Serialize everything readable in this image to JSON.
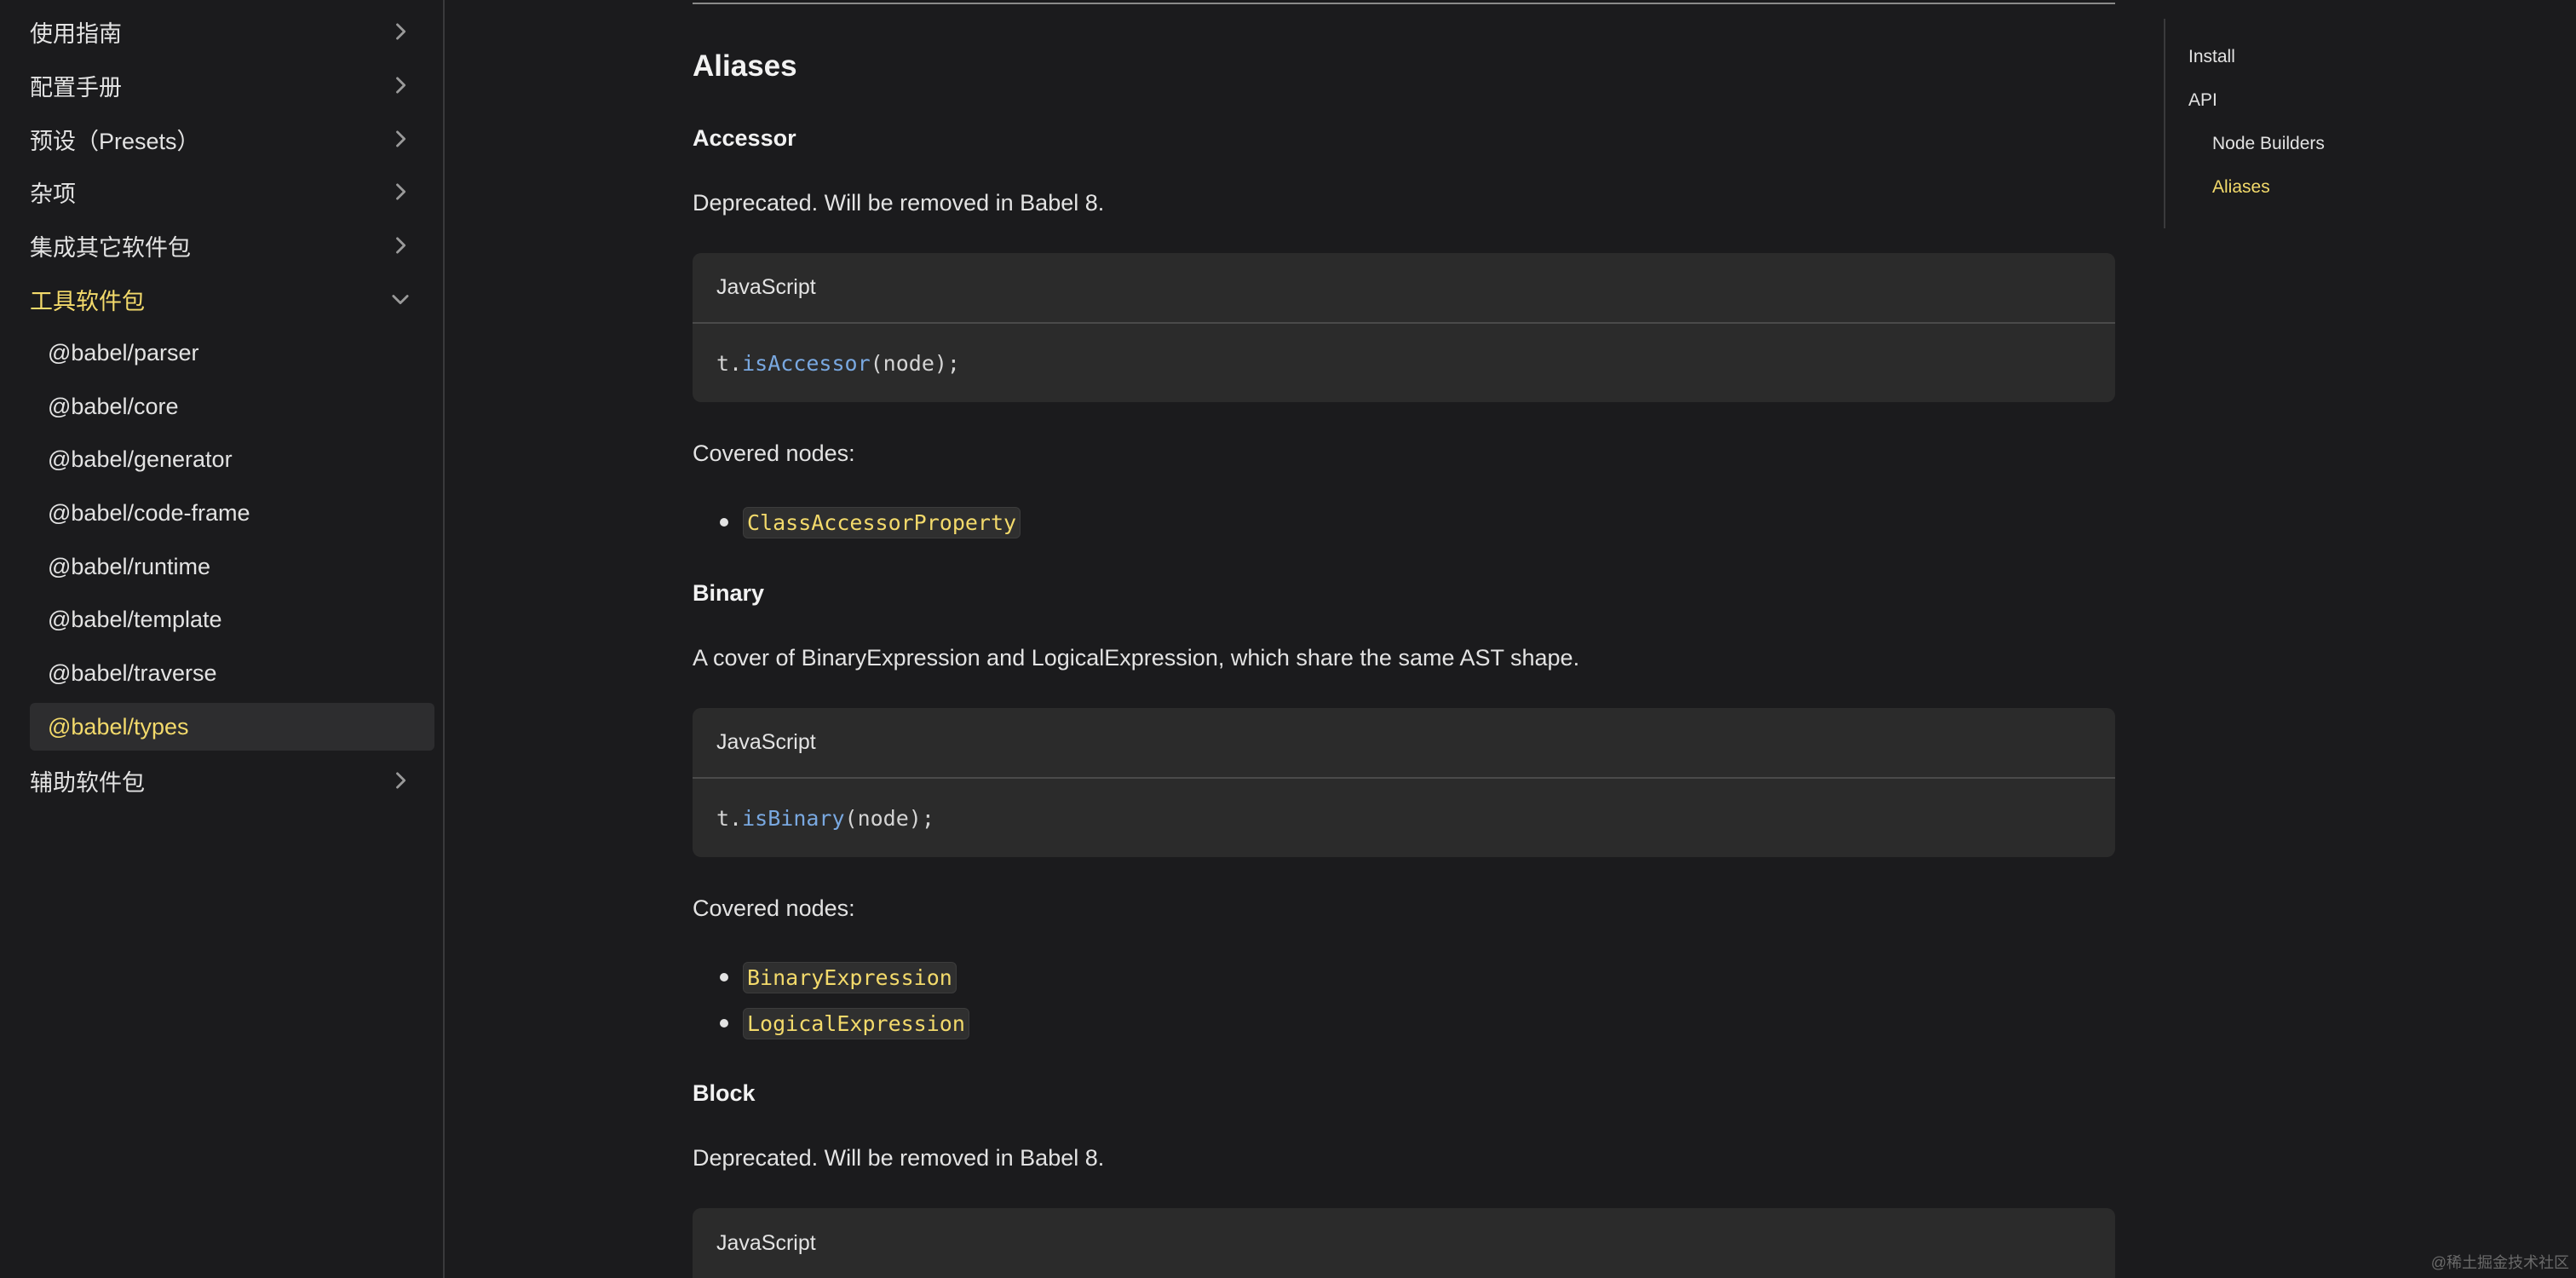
{
  "sidebar": {
    "categories": [
      {
        "label": "使用指南"
      },
      {
        "label": "配置手册"
      },
      {
        "label": "预设（Presets）"
      },
      {
        "label": "杂项"
      },
      {
        "label": "集成其它软件包"
      },
      {
        "label": "工具软件包"
      },
      {
        "label": "辅助软件包"
      }
    ],
    "sub_items": [
      {
        "label": "@babel/parser"
      },
      {
        "label": "@babel/core"
      },
      {
        "label": "@babel/generator"
      },
      {
        "label": "@babel/code-frame"
      },
      {
        "label": "@babel/runtime"
      },
      {
        "label": "@babel/template"
      },
      {
        "label": "@babel/traverse"
      },
      {
        "label": "@babel/types"
      }
    ]
  },
  "main": {
    "heading": "Aliases",
    "accessor": {
      "title": "Accessor",
      "desc": "Deprecated. Will be removed in Babel 8.",
      "code_lang": "JavaScript",
      "code_prefix": "t.",
      "code_fn": "isAccessor",
      "code_suffix": "(node);",
      "covered_label": "Covered nodes:",
      "nodes": [
        "ClassAccessorProperty"
      ]
    },
    "binary": {
      "title": "Binary",
      "desc": "A cover of BinaryExpression and LogicalExpression, which share the same AST shape.",
      "code_lang": "JavaScript",
      "code_prefix": "t.",
      "code_fn": "isBinary",
      "code_suffix": "(node);",
      "covered_label": "Covered nodes:",
      "nodes": [
        "BinaryExpression",
        "LogicalExpression"
      ]
    },
    "block": {
      "title": "Block",
      "desc": "Deprecated. Will be removed in Babel 8.",
      "code_lang": "JavaScript"
    }
  },
  "toc": {
    "items": [
      {
        "label": "Install"
      },
      {
        "label": "API"
      },
      {
        "label": "Node Builders"
      },
      {
        "label": "Aliases"
      }
    ]
  },
  "watermark": "@稀土掘金技术社区",
  "colors": {
    "accent": "#f3da6b",
    "background": "#1b1b1d",
    "code_bg": "#2b2b2b",
    "function": "#79a8e0"
  }
}
